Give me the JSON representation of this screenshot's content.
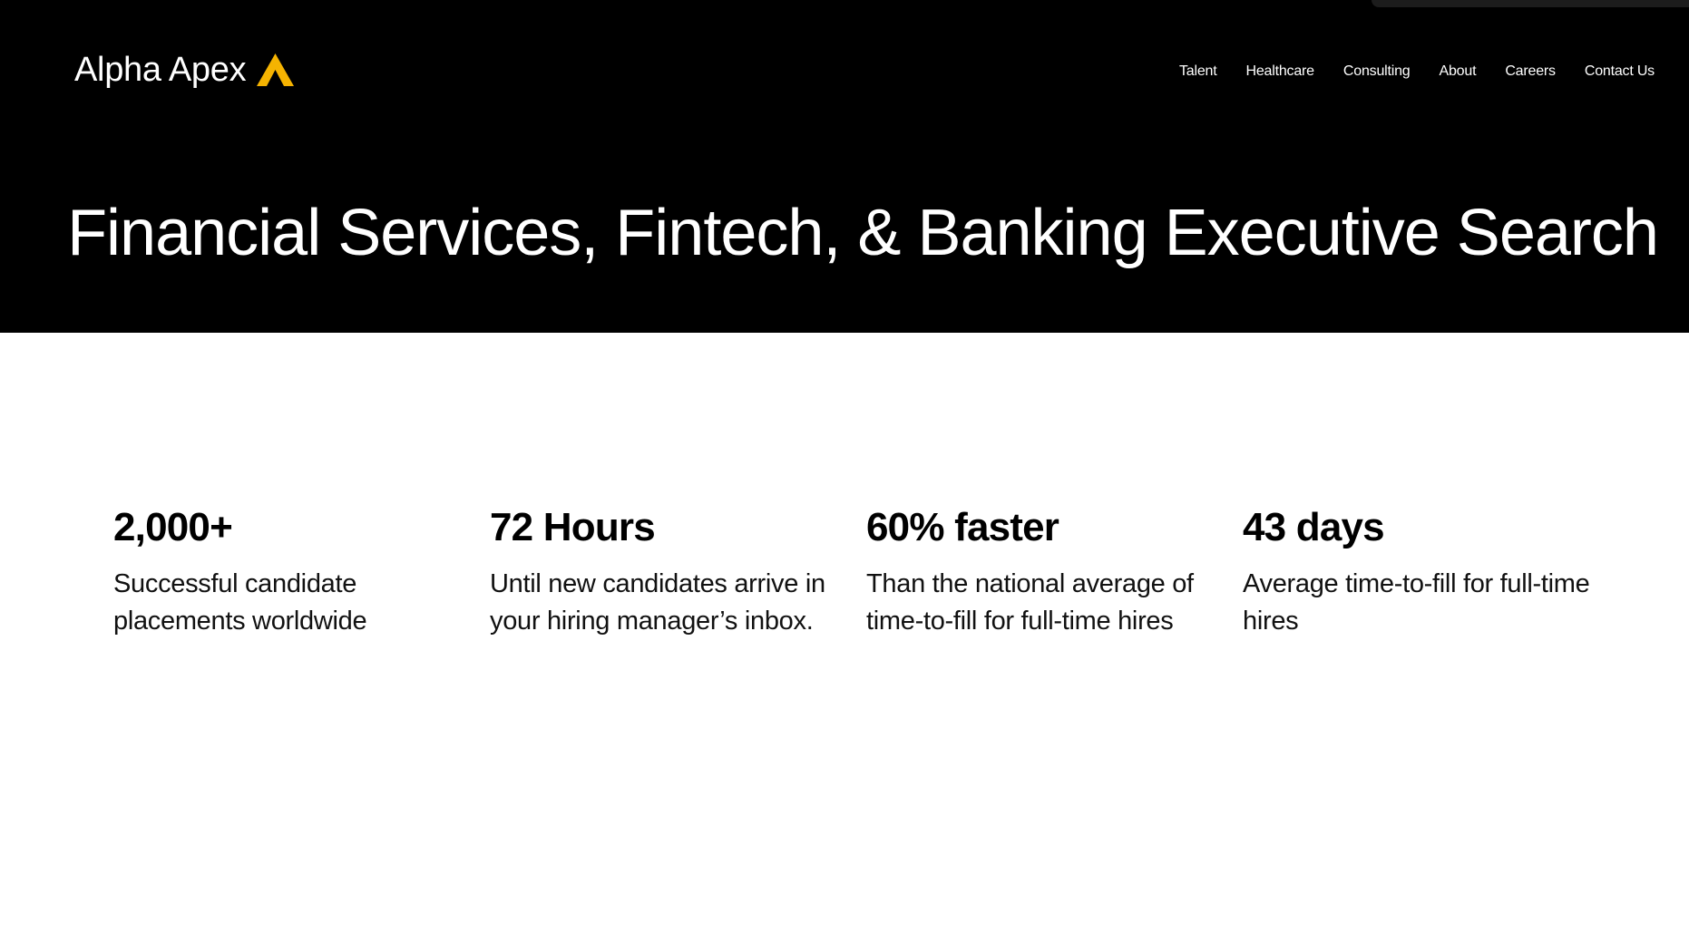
{
  "brand": {
    "name": "Alpha Apex",
    "logo_icon": "triangle-a-icon",
    "accent_color": "#F5B301"
  },
  "nav": {
    "items": [
      "Talent",
      "Healthcare",
      "Consulting",
      "About",
      "Careers",
      "Contact Us"
    ]
  },
  "hero": {
    "title": "Financial Services, Fintech, & Banking Executive Search",
    "background": "#000000"
  },
  "stats": [
    {
      "value": "2,000+",
      "description": "Successful candidate placements worldwide"
    },
    {
      "value": "72 Hours",
      "description": "Until new candidates arrive in your hiring manager’s inbox."
    },
    {
      "value": "60% faster",
      "description": "Than the national average of time-to-fill for full-time hires"
    },
    {
      "value": "43 days",
      "description": "Average time-to-fill for full-time hires"
    }
  ]
}
